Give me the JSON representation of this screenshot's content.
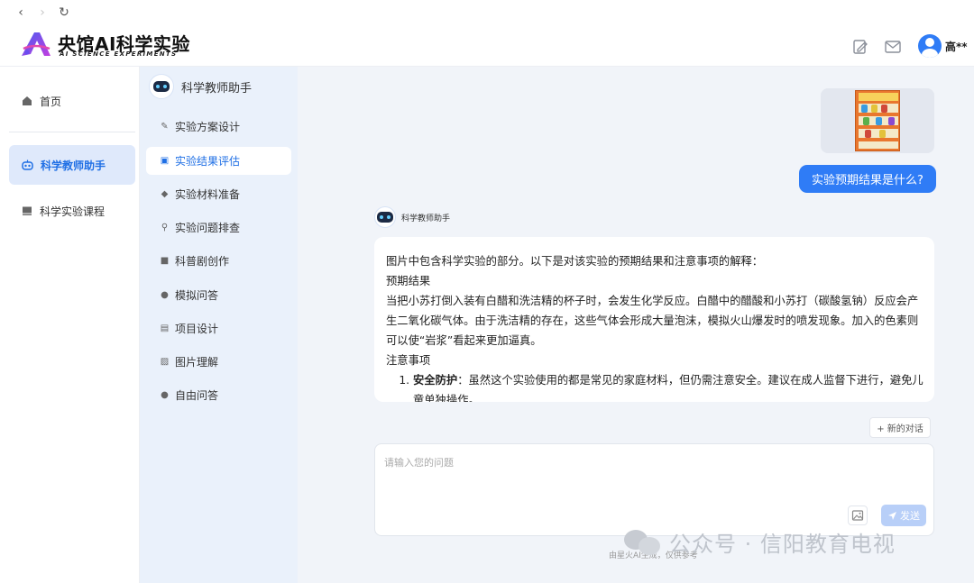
{
  "browser": {
    "back_icon": "‹",
    "forward_icon": "›",
    "refresh_icon": "↻"
  },
  "header": {
    "logo_title": "央馆AI科学实验",
    "logo_subtitle": "AI SCIENCE EXPERIMENTS",
    "user_name": "高**",
    "icons": [
      "edit-note-icon",
      "mail-icon",
      "user-avatar-icon"
    ]
  },
  "sidebar": {
    "items": [
      {
        "label": "首页",
        "icon": "home-icon",
        "active": false
      },
      {
        "label": "科学教师助手",
        "icon": "bot-icon",
        "active": true
      },
      {
        "label": "科学实验课程",
        "icon": "course-icon",
        "active": false
      }
    ]
  },
  "subnav": {
    "title": "科学教师助手",
    "items": [
      {
        "label": "实验方案设计",
        "icon": "pen-icon"
      },
      {
        "label": "实验结果评估",
        "icon": "edit-icon",
        "active": true
      },
      {
        "label": "实验材料准备",
        "icon": "cube-icon"
      },
      {
        "label": "实验问题排查",
        "icon": "search-icon"
      },
      {
        "label": "科普剧创作",
        "icon": "video-icon"
      },
      {
        "label": "模拟问答",
        "icon": "question-icon"
      },
      {
        "label": "项目设计",
        "icon": "doc-icon"
      },
      {
        "label": "图片理解",
        "icon": "image-icon"
      },
      {
        "label": "自由问答",
        "icon": "chat-icon"
      }
    ]
  },
  "chat": {
    "user_question": "实验预期结果是什么?",
    "bot_name": "科学教师助手",
    "answer": {
      "intro": "图片中包含科学实验的部分。以下是对该实验的预期结果和注意事项的解释：",
      "heading1": "预期结果",
      "paragraph1": "当把小苏打倒入装有白醋和洗洁精的杯子时，会发生化学反应。白醋中的醋酸和小苏打（碳酸氢钠）反应会产生二氧化碳气体。由于洗洁精的存在，这些气体会形成大量泡沫，模拟火山爆发时的喷发现象。加入的色素则可以使“岩浆”看起来更加逼真。",
      "heading2": "注意事项",
      "list": [
        {
          "bold": "安全防护",
          "text": "：虽然这个实验使用的都是常见的家庭材料，但仍需注意安全。建议在成人监督下进行，避免儿童单独操作。"
        }
      ]
    },
    "new_chat_label": "+ 新的对话",
    "input_placeholder": "请输入您的问题",
    "send_label": "发送",
    "footer_note": "由星火AI生成，仅供参考"
  },
  "watermark": {
    "text": "公众号 · 信阳教育电视"
  },
  "colors": {
    "accent": "#2f7cf6",
    "active_bg": "#dfe9fb",
    "subnav_bg": "#eaf1fb",
    "main_bg": "#f1f4f9",
    "send_disabled": "#b8cff8"
  }
}
